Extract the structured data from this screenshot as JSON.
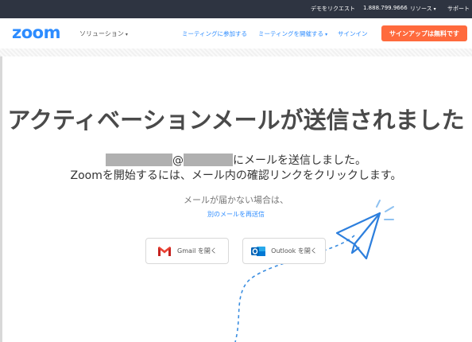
{
  "topbar": {
    "demo": "デモをリクエスト",
    "phone": "1.888.799.9666",
    "resources": "リソース",
    "support": "サポート"
  },
  "header": {
    "logo": "zoom",
    "solutions": "ソリューション",
    "join": "ミーティングに参加する",
    "host": "ミーティングを開催する",
    "signin": "サインイン",
    "signup": "サインアップは無料です"
  },
  "main": {
    "headline": "アクティベーションメールが送信されました",
    "line1_at": "@",
    "line1_suffix": "にメールを送信しました。",
    "line2": "Zoomを開始するには、メール内の確認リンクをクリックします。",
    "no_receive": "メールが届かない場合は、",
    "resend": "別のメールを再送信",
    "gmail_label": "Gmail を開く",
    "outlook_label": "Outlook を開く"
  },
  "icons": {
    "gmail": "gmail-icon",
    "outlook": "outlook-icon",
    "plane": "paper-plane-icon"
  },
  "colors": {
    "accent": "#2d8cff",
    "signup": "#ff6a3d",
    "topbar": "#2e3441",
    "redaction": "#b0b0b0"
  }
}
